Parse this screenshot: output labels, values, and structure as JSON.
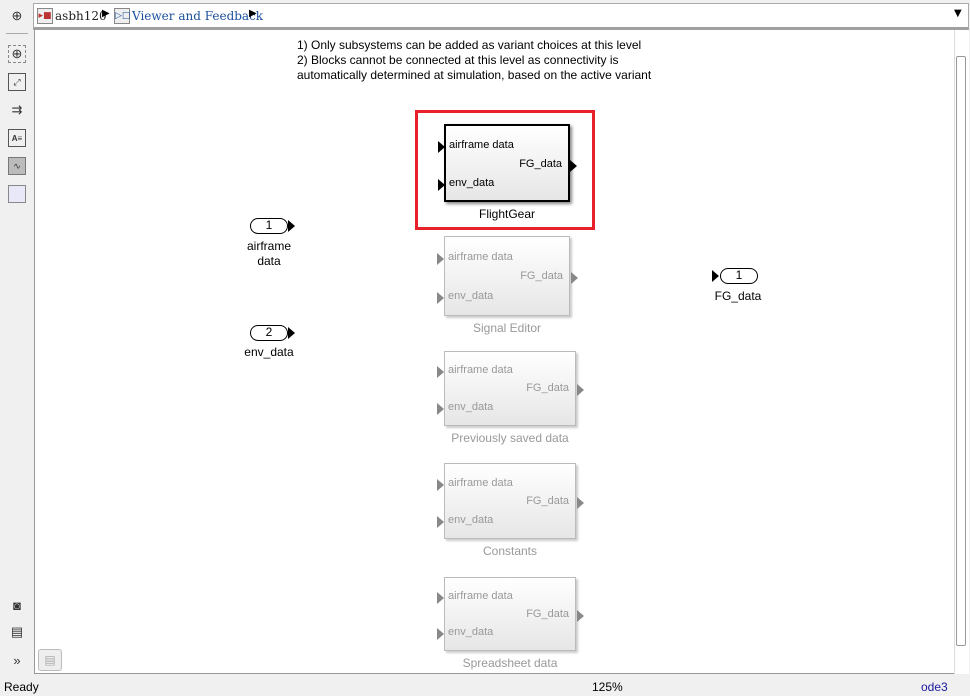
{
  "breadcrumb": {
    "items": [
      "asbh120",
      "Viewer and Feedback"
    ]
  },
  "toolbar": {
    "icons": [
      "back-icon",
      "zoom-icon",
      "fit-view-icon",
      "signal-route-icon",
      "annotation-icon",
      "image-icon",
      "area-icon",
      "camera-icon",
      "property-inspector-icon",
      "expand-icon"
    ]
  },
  "annotation": {
    "lines": [
      "1) Only subsystems can be added as variant choices at this level",
      "2) Blocks cannot be connected at this level as connectivity is",
      "automatically determined at simulation, based on the active variant"
    ]
  },
  "blocks": [
    {
      "name": "FlightGear",
      "in1": "airframe data",
      "in2": "env_data",
      "out": "FG_data",
      "active": true
    },
    {
      "name": "Signal Editor",
      "in1": "airframe data",
      "in2": "env_data",
      "out": "FG_data"
    },
    {
      "name": "Previously saved data",
      "in1": "airframe data",
      "in2": "env_data",
      "out": "FG_data"
    },
    {
      "name": "Constants",
      "in1": "airframe data",
      "in2": "env_data",
      "out": "FG_data"
    },
    {
      "name": "Spreadsheet data",
      "in1": "airframe data",
      "in2": "env_data",
      "out": "FG_data"
    }
  ],
  "inports": [
    {
      "num": "1",
      "label1": "airframe",
      "label2": "data"
    },
    {
      "num": "2",
      "label1": "env_data"
    }
  ],
  "outport": {
    "num": "1",
    "label": "FG_data"
  },
  "status": {
    "state": "Ready",
    "zoom": "125%",
    "solver": "ode3"
  },
  "colors": {
    "highlight": "#e8202a",
    "solver_link": "#1a1aa0"
  }
}
